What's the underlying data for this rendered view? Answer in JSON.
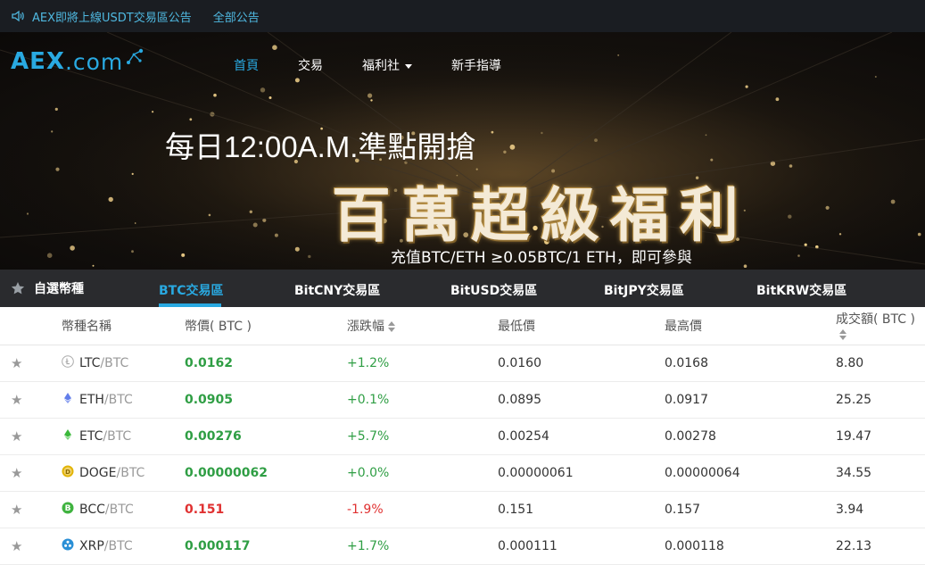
{
  "notice": {
    "text": "AEX即將上線USDT交易區公告",
    "all": "全部公告"
  },
  "logo": {
    "brand": "AEX",
    "suffix": ".com"
  },
  "menu": {
    "items": [
      "首頁",
      "交易",
      "福利社",
      "新手指導"
    ]
  },
  "hero": {
    "line1": "每日12:00A.M.準點開搶",
    "line2": "百萬超級福利",
    "line3": "充值BTC/ETH ≥0.05BTC/1 ETH，即可參與"
  },
  "tabs": {
    "favorites": "自選幣種",
    "items": [
      "BTC交易區",
      "BitCNY交易區",
      "BitUSD交易區",
      "BitJPY交易區",
      "BitKRW交易區"
    ]
  },
  "table": {
    "headers": [
      "幣種名稱",
      "幣價( BTC )",
      "漲跌幅",
      "最低價",
      "最高價",
      "成交額( BTC )"
    ],
    "rows": [
      {
        "coin": "LTC",
        "base": "/BTC",
        "price": "0.0162",
        "change": "+1.2%",
        "low": "0.0160",
        "high": "0.0168",
        "volume": "8.80",
        "dir": "up",
        "icon": "litecoin-icon"
      },
      {
        "coin": "ETH",
        "base": "/BTC",
        "price": "0.0905",
        "change": "+0.1%",
        "low": "0.0895",
        "high": "0.0917",
        "volume": "25.25",
        "dir": "up",
        "icon": "ethereum-icon"
      },
      {
        "coin": "ETC",
        "base": "/BTC",
        "price": "0.00276",
        "change": "+5.7%",
        "low": "0.00254",
        "high": "0.00278",
        "volume": "19.47",
        "dir": "up",
        "icon": "ethereum-classic-icon"
      },
      {
        "coin": "DOGE",
        "base": "/BTC",
        "price": "0.00000062",
        "change": "+0.0%",
        "low": "0.00000061",
        "high": "0.00000064",
        "volume": "34.55",
        "dir": "up",
        "icon": "dogecoin-icon"
      },
      {
        "coin": "BCC",
        "base": "/BTC",
        "price": "0.151",
        "change": "-1.9%",
        "low": "0.151",
        "high": "0.157",
        "volume": "3.94",
        "dir": "down",
        "icon": "bitcoin-cash-icon"
      },
      {
        "coin": "XRP",
        "base": "/BTC",
        "price": "0.000117",
        "change": "+1.7%",
        "low": "0.000111",
        "high": "0.000118",
        "volume": "22.13",
        "dir": "up",
        "icon": "ripple-icon"
      }
    ]
  },
  "colors": {
    "accent": "#29a9e1",
    "up": "#2f9e44",
    "down": "#e03131"
  }
}
